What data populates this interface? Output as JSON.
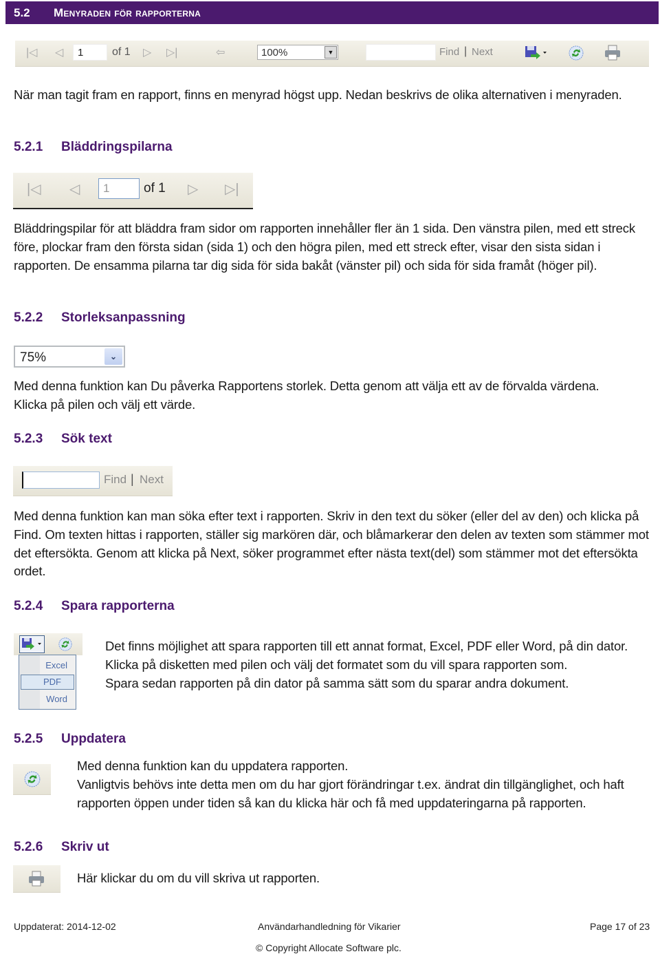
{
  "section": {
    "number": "5.2",
    "title": "Menyraden för rapporterna"
  },
  "toolbar": {
    "page_value": "1",
    "of_label": "of 1",
    "zoom_value": "100%",
    "search_value": "",
    "find_label": "Find",
    "separator": "|",
    "next_label": "Next",
    "icons": [
      "first-page-icon",
      "prev-page-icon",
      "next-page-icon",
      "last-page-icon",
      "back-icon",
      "save-icon",
      "refresh-icon",
      "print-icon"
    ]
  },
  "intro": "När man tagit fram en rapport, finns en menyrad högst upp. Nedan beskrivs de olika alternativen i menyraden.",
  "subsections": [
    {
      "number": "5.2.1",
      "title": "Bläddringspilarna",
      "image": {
        "page_value": "1",
        "of_label": "of 1"
      },
      "text": "Bläddringspilar för att bläddra fram sidor om rapporten innehåller fler än 1 sida. Den vänstra pilen, med ett streck före, plockar fram den första sidan (sida 1) och den högra pilen, med ett streck efter, visar den sista sidan i rapporten. De ensamma pilarna tar dig sida för sida bakåt (vänster pil) och sida för sida framåt (höger pil)."
    },
    {
      "number": "5.2.2",
      "title": "Storleksanpassning",
      "image": {
        "zoom_value": "75%"
      },
      "text": "Med denna funktion kan Du påverka Rapportens storlek. Detta genom att välja ett av de förvalda värdena. Klicka på pilen och välj ett värde."
    },
    {
      "number": "5.2.3",
      "title": "Sök text",
      "image": {
        "search_value": "",
        "find_label": "Find",
        "separator": "|",
        "next_label": "Next"
      },
      "text": "Med denna funktion kan man söka efter text i rapporten. Skriv in den text du söker (eller del av den) och klicka på Find. Om texten hittas i rapporten, ställer sig markören där, och blåmarkerar den delen av texten som stämmer mot det eftersökta. Genom att klicka på Next, söker programmet efter nästa text(del) som stämmer mot det eftersökta ordet."
    },
    {
      "number": "5.2.4",
      "title": "Spara rapporterna",
      "image": {
        "menu_items": [
          "Excel",
          "PDF",
          "Word"
        ],
        "highlighted": "PDF"
      },
      "text_lines": [
        "Det finns möjlighet att spara rapporten till ett annat format, Excel, PDF eller Word, på din dator.",
        "Klicka på disketten med pilen och välj det formatet som du vill spara rapporten som.",
        "Spara sedan rapporten på din dator på samma sätt som du sparar andra dokument."
      ]
    },
    {
      "number": "5.2.5",
      "title": "Uppdatera",
      "text_lines": [
        "Med denna funktion kan du uppdatera rapporten.",
        "Vanligtvis behövs inte detta men om du har gjort förändringar t.ex. ändrat din tillgänglighet, och haft rapporten öppen under tiden så kan du klicka här och få med uppdateringarna på rapporten."
      ]
    },
    {
      "number": "5.2.6",
      "title": "Skriv ut",
      "text": "Här klickar du om du vill skriva ut rapporten."
    }
  ],
  "footer": {
    "updated": "Uppdaterat: 2014-12-02",
    "doc_title": "Användarhandledning för Vikarier",
    "page": "Page 17 of 23",
    "copyright": "© Copyright Allocate Software plc."
  },
  "colors": {
    "heading_purple": "#4b1a6e",
    "toolbar_bg": "#ebe8dc"
  }
}
